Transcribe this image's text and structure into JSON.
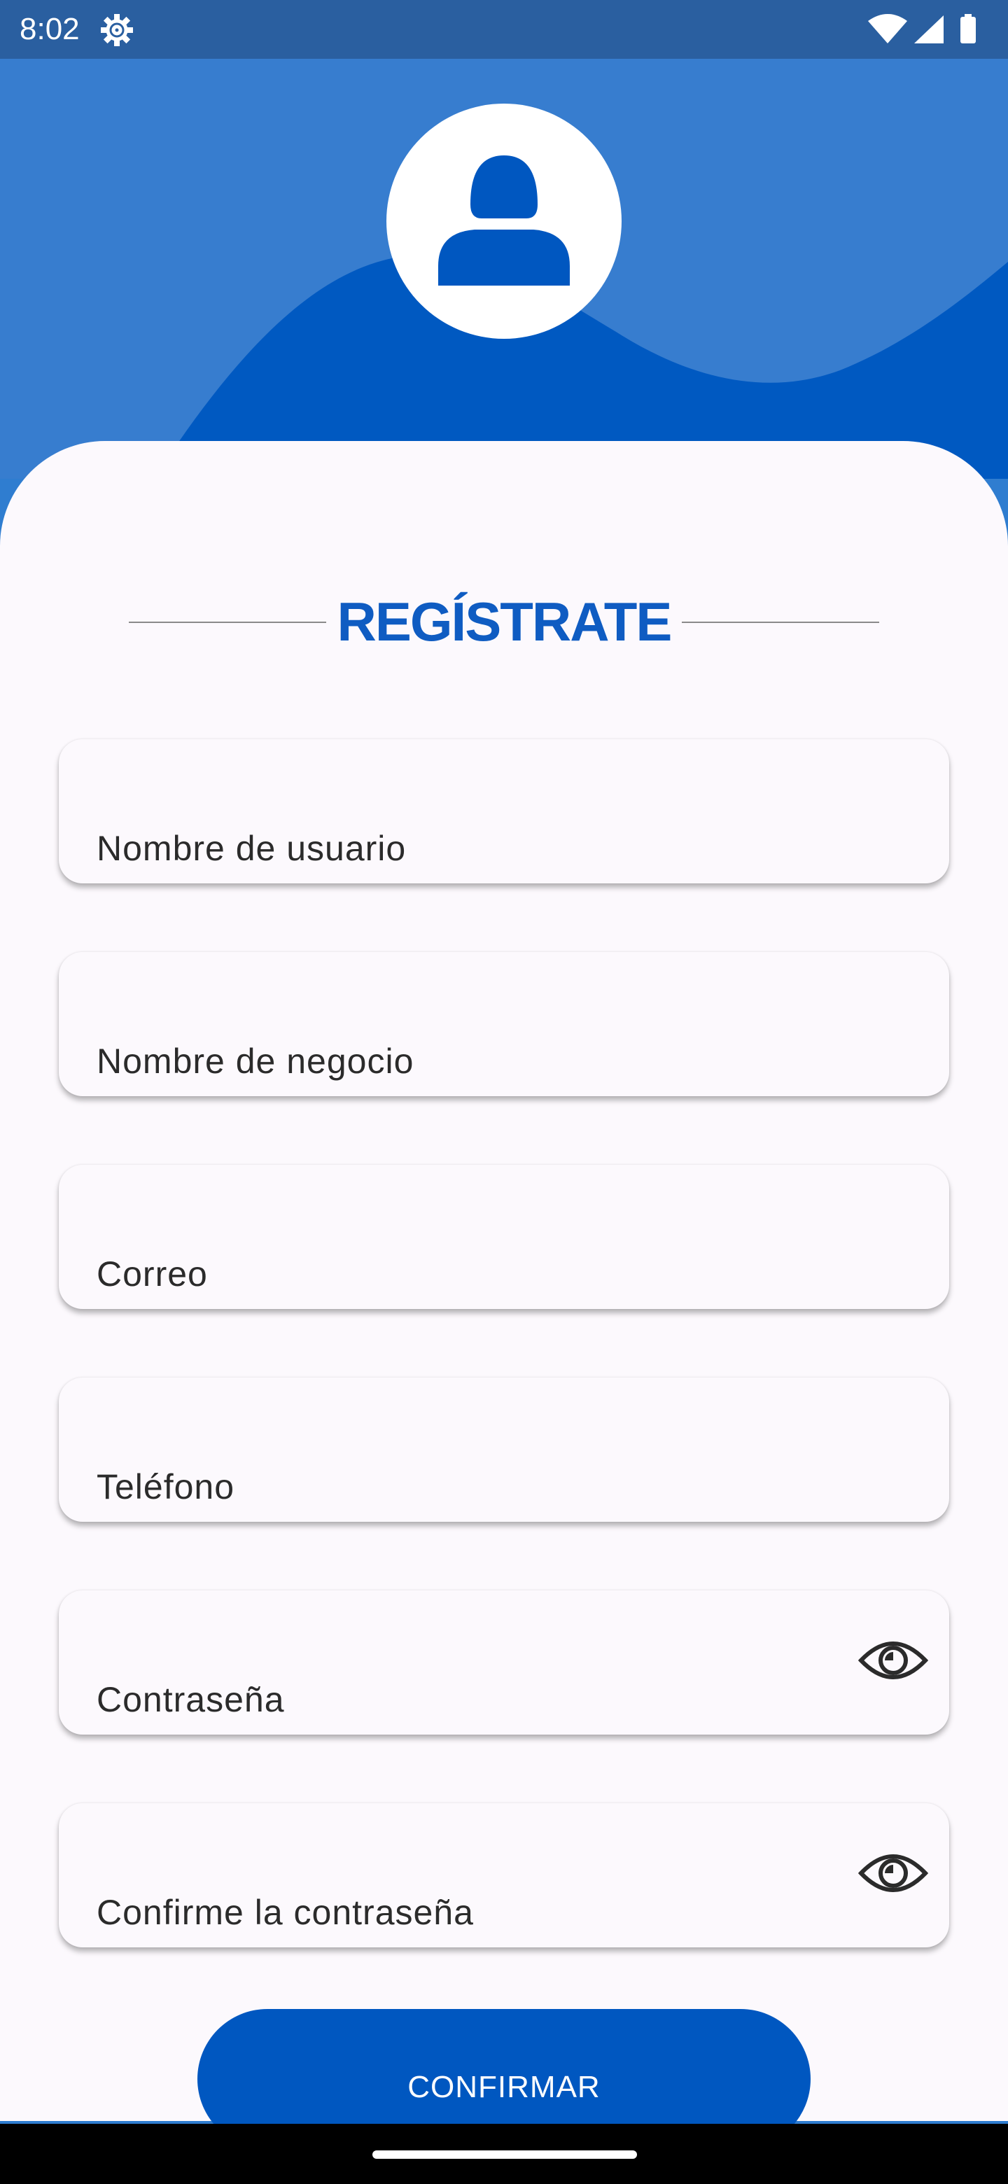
{
  "status_bar": {
    "time": "8:02",
    "icons": [
      "settings-gear-icon",
      "wifi-icon",
      "signal-icon",
      "battery-icon"
    ]
  },
  "header": {
    "avatar_icon": "user-silhouette-icon"
  },
  "form": {
    "title": "REGÍSTRATE",
    "fields": [
      {
        "label": "Nombre de usuario",
        "value": ""
      },
      {
        "label": "Nombre de negocio",
        "value": ""
      },
      {
        "label": "Correo",
        "value": ""
      },
      {
        "label": "Teléfono",
        "value": ""
      },
      {
        "label": "Contraseña",
        "value": "",
        "trailing_icon": "eye-icon"
      },
      {
        "label": "Confirme la contraseña",
        "value": "",
        "trailing_icon": "eye-icon"
      }
    ],
    "confirm_label": "CONFIRMAR"
  },
  "colors": {
    "primary": "#0057c0",
    "header_light": "#377dcf",
    "status_bar": "#2a5fa0",
    "surface": "#fcf9fd"
  }
}
